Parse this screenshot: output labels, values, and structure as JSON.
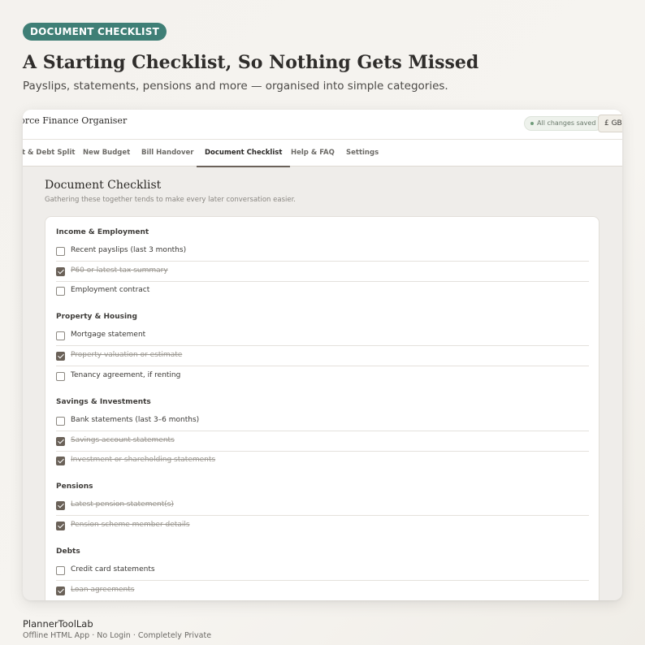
{
  "badge": "DOCUMENT CHECKLIST",
  "hero": {
    "title": "A Starting Checklist, So Nothing Gets Missed",
    "subtitle": "Payslips, statements, pensions and more — organised into simple categories."
  },
  "app": {
    "title": "vorce Finance Organiser",
    "saved_status": "All changes saved",
    "currency": "£ GBP",
    "tabs": [
      {
        "label": "t & Debt Split"
      },
      {
        "label": "New Budget"
      },
      {
        "label": "Bill Handover"
      },
      {
        "label": "Document Checklist"
      },
      {
        "label": "Help & FAQ"
      },
      {
        "label": "Settings"
      }
    ],
    "active_tab": "Document Checklist",
    "page_title": "Document Checklist",
    "page_subtitle": "Gathering these together tends to make every later conversation easier.",
    "sections": [
      {
        "name": "Income & Employment",
        "items": [
          {
            "label": "Recent payslips (last 3 months)",
            "checked": false
          },
          {
            "label": "P60 or latest tax summary",
            "checked": true
          },
          {
            "label": "Employment contract",
            "checked": false
          }
        ]
      },
      {
        "name": "Property & Housing",
        "items": [
          {
            "label": "Mortgage statement",
            "checked": false
          },
          {
            "label": "Property valuation or estimate",
            "checked": true
          },
          {
            "label": "Tenancy agreement, if renting",
            "checked": false
          }
        ]
      },
      {
        "name": "Savings & Investments",
        "items": [
          {
            "label": "Bank statements (last 3–6 months)",
            "checked": false
          },
          {
            "label": "Savings account statements",
            "checked": true
          },
          {
            "label": "Investment or shareholding statements",
            "checked": true
          }
        ]
      },
      {
        "name": "Pensions",
        "items": [
          {
            "label": "Latest pension statement(s)",
            "checked": true
          },
          {
            "label": "Pension scheme member details",
            "checked": true
          }
        ]
      },
      {
        "name": "Debts",
        "items": [
          {
            "label": "Credit card statements",
            "checked": false
          },
          {
            "label": "Loan agreements",
            "checked": true
          }
        ]
      }
    ]
  },
  "footer": {
    "brand": "PlannerToolLab",
    "tagline": "Offline HTML App  ·  No Login  ·  Completely Private"
  },
  "colors": {
    "accent": "#3f7f76",
    "checkbox_checked": "#6a6158",
    "active_tab_underline": "#6b625a"
  }
}
